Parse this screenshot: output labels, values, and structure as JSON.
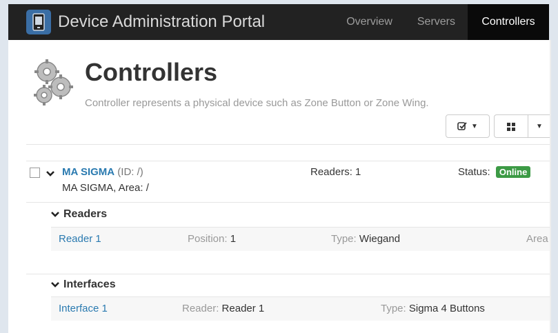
{
  "app": {
    "title": "Device Administration Portal",
    "nav": [
      {
        "label": "Overview"
      },
      {
        "label": "Servers"
      },
      {
        "label": "Controllers",
        "active": true
      }
    ]
  },
  "page": {
    "title": "Controllers",
    "description": "Controller represents a physical device such as Zone Button or Zone Wing."
  },
  "controller": {
    "name": "MA SIGMA",
    "id_text": "(ID: /)",
    "subtitle": "MA SIGMA, Area: /",
    "readers_text": "Readers: 1",
    "status_label": "Status:",
    "status_value": "Online",
    "status_color": "#3c9a45"
  },
  "readers": {
    "heading": "Readers",
    "items": [
      {
        "name": "Reader 1",
        "position_label": "Position:",
        "position_value": "1",
        "type_label": "Type:",
        "type_value": "Wiegand",
        "area_label": "Area"
      }
    ]
  },
  "interfaces": {
    "heading": "Interfaces",
    "items": [
      {
        "name": "Interface 1",
        "reader_label": "Reader:",
        "reader_value": "Reader 1",
        "type_label": "Type:",
        "type_value": "Sigma 4 Buttons"
      }
    ]
  },
  "icons": [
    "device-icon",
    "gears-icon",
    "checklist-icon",
    "caret-down-icon",
    "grid-icon",
    "chevron-down-icon"
  ]
}
